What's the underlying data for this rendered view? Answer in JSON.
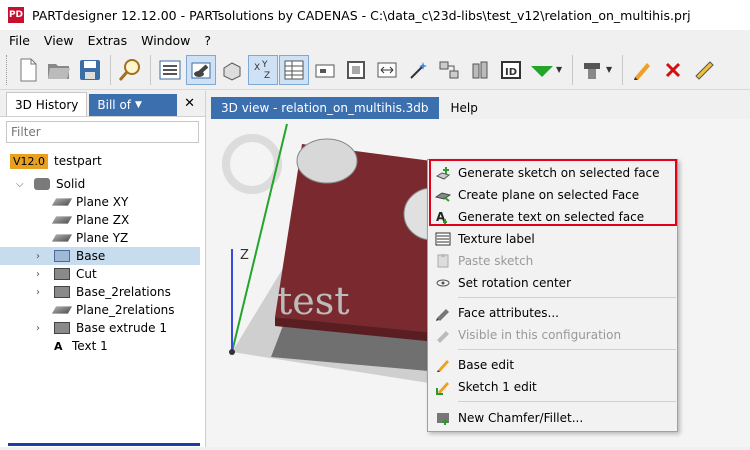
{
  "window": {
    "title": "PARTdesigner 12.12.00 - PARTsolutions by CADENAS - C:\\data_c\\23d-libs\\test_v12\\relation_on_multihis.prj",
    "app_icon_text": "PD"
  },
  "menu": [
    "File",
    "View",
    "Extras",
    "Window",
    "?"
  ],
  "toolbar": {
    "buttons": [
      "new-file",
      "open-folder",
      "save",
      "search",
      "view-list",
      "cylinder-view",
      "shaded-box",
      "xyz-axes",
      "table",
      "dimension",
      "frame",
      "resize",
      "magic-wand",
      "connect",
      "cylinders",
      "id-tag",
      "green-arrow",
      "screw",
      "pencil",
      "delete-x",
      "ruler"
    ],
    "id_label": "ID"
  },
  "left_panel": {
    "tab_active": "3D History",
    "tab_inactive": "Bill of",
    "filter_placeholder": "Filter",
    "version": "V12.0",
    "part_name": "testpart",
    "tree": [
      {
        "label": "Solid",
        "icon": "solid-icon",
        "expanded": true,
        "level": 0
      },
      {
        "label": "Plane XY",
        "icon": "plane-icon",
        "level": 1
      },
      {
        "label": "Plane ZX",
        "icon": "plane-icon",
        "level": 1
      },
      {
        "label": "Plane YZ",
        "icon": "plane-icon",
        "level": 1
      },
      {
        "label": "Base",
        "icon": "box-icon",
        "level": 1,
        "selected": true,
        "collapsed": true
      },
      {
        "label": "Cut",
        "icon": "grey-box-icon",
        "level": 1,
        "collapsed": true
      },
      {
        "label": "Base_2relations",
        "icon": "grey-box-icon",
        "level": 1,
        "collapsed": true
      },
      {
        "label": "Plane_2relations",
        "icon": "plane-icon",
        "level": 1
      },
      {
        "label": "Base extrude 1",
        "icon": "grey-box-icon",
        "level": 1,
        "collapsed": true
      },
      {
        "label": "Text 1",
        "icon": "text-icon",
        "level": 1
      }
    ]
  },
  "view": {
    "tab_active": "3D view - relation_on_multihis.3db",
    "tab_help": "Help",
    "axis_label": "Z",
    "model_text": "test",
    "model_color": "#7a2a2e"
  },
  "context_menu": {
    "items": [
      {
        "label": "Generate sketch on selected face",
        "icon": "sketch-face-icon",
        "disabled": false
      },
      {
        "label": "Create plane on selected Face",
        "icon": "plane-face-icon",
        "disabled": false
      },
      {
        "label": "Generate text on selected face",
        "icon": "text-face-icon",
        "disabled": false
      },
      {
        "label": "Texture label",
        "icon": "texture-icon",
        "disabled": false
      },
      {
        "label": "Paste sketch",
        "icon": "paste-sketch-icon",
        "disabled": true
      },
      {
        "label": "Set rotation center",
        "icon": "rotation-icon",
        "disabled": false
      },
      {
        "label": "Face attributes...",
        "icon": "face-attributes-icon",
        "disabled": false
      },
      {
        "label": "Visible in this configuration",
        "icon": "visibility-icon",
        "disabled": true
      },
      {
        "label": "Base edit",
        "icon": "pencil-icon",
        "disabled": false
      },
      {
        "label": "Sketch 1 edit",
        "icon": "sketch-edit-icon",
        "disabled": false
      },
      {
        "label": "New Chamfer/Fillet...",
        "icon": "chamfer-icon",
        "disabled": false
      }
    ],
    "highlight_color": "#e2001a"
  }
}
